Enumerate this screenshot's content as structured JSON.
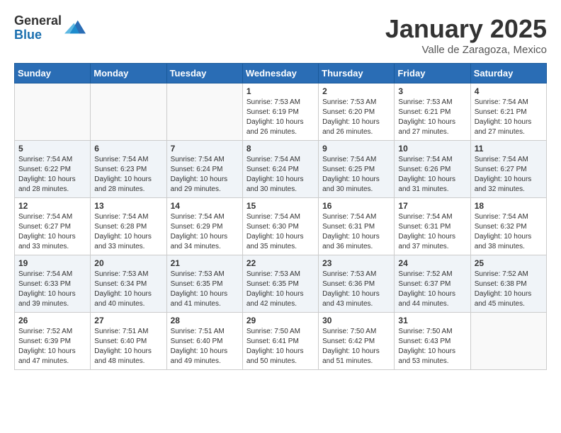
{
  "header": {
    "logo_general": "General",
    "logo_blue": "Blue",
    "month_title": "January 2025",
    "location": "Valle de Zaragoza, Mexico"
  },
  "days_of_week": [
    "Sunday",
    "Monday",
    "Tuesday",
    "Wednesday",
    "Thursday",
    "Friday",
    "Saturday"
  ],
  "weeks": [
    [
      {
        "day": "",
        "sunrise": "",
        "sunset": "",
        "daylight": ""
      },
      {
        "day": "",
        "sunrise": "",
        "sunset": "",
        "daylight": ""
      },
      {
        "day": "",
        "sunrise": "",
        "sunset": "",
        "daylight": ""
      },
      {
        "day": "1",
        "sunrise": "Sunrise: 7:53 AM",
        "sunset": "Sunset: 6:19 PM",
        "daylight": "Daylight: 10 hours and 26 minutes."
      },
      {
        "day": "2",
        "sunrise": "Sunrise: 7:53 AM",
        "sunset": "Sunset: 6:20 PM",
        "daylight": "Daylight: 10 hours and 26 minutes."
      },
      {
        "day": "3",
        "sunrise": "Sunrise: 7:53 AM",
        "sunset": "Sunset: 6:21 PM",
        "daylight": "Daylight: 10 hours and 27 minutes."
      },
      {
        "day": "4",
        "sunrise": "Sunrise: 7:54 AM",
        "sunset": "Sunset: 6:21 PM",
        "daylight": "Daylight: 10 hours and 27 minutes."
      }
    ],
    [
      {
        "day": "5",
        "sunrise": "Sunrise: 7:54 AM",
        "sunset": "Sunset: 6:22 PM",
        "daylight": "Daylight: 10 hours and 28 minutes."
      },
      {
        "day": "6",
        "sunrise": "Sunrise: 7:54 AM",
        "sunset": "Sunset: 6:23 PM",
        "daylight": "Daylight: 10 hours and 28 minutes."
      },
      {
        "day": "7",
        "sunrise": "Sunrise: 7:54 AM",
        "sunset": "Sunset: 6:24 PM",
        "daylight": "Daylight: 10 hours and 29 minutes."
      },
      {
        "day": "8",
        "sunrise": "Sunrise: 7:54 AM",
        "sunset": "Sunset: 6:24 PM",
        "daylight": "Daylight: 10 hours and 30 minutes."
      },
      {
        "day": "9",
        "sunrise": "Sunrise: 7:54 AM",
        "sunset": "Sunset: 6:25 PM",
        "daylight": "Daylight: 10 hours and 30 minutes."
      },
      {
        "day": "10",
        "sunrise": "Sunrise: 7:54 AM",
        "sunset": "Sunset: 6:26 PM",
        "daylight": "Daylight: 10 hours and 31 minutes."
      },
      {
        "day": "11",
        "sunrise": "Sunrise: 7:54 AM",
        "sunset": "Sunset: 6:27 PM",
        "daylight": "Daylight: 10 hours and 32 minutes."
      }
    ],
    [
      {
        "day": "12",
        "sunrise": "Sunrise: 7:54 AM",
        "sunset": "Sunset: 6:27 PM",
        "daylight": "Daylight: 10 hours and 33 minutes."
      },
      {
        "day": "13",
        "sunrise": "Sunrise: 7:54 AM",
        "sunset": "Sunset: 6:28 PM",
        "daylight": "Daylight: 10 hours and 33 minutes."
      },
      {
        "day": "14",
        "sunrise": "Sunrise: 7:54 AM",
        "sunset": "Sunset: 6:29 PM",
        "daylight": "Daylight: 10 hours and 34 minutes."
      },
      {
        "day": "15",
        "sunrise": "Sunrise: 7:54 AM",
        "sunset": "Sunset: 6:30 PM",
        "daylight": "Daylight: 10 hours and 35 minutes."
      },
      {
        "day": "16",
        "sunrise": "Sunrise: 7:54 AM",
        "sunset": "Sunset: 6:31 PM",
        "daylight": "Daylight: 10 hours and 36 minutes."
      },
      {
        "day": "17",
        "sunrise": "Sunrise: 7:54 AM",
        "sunset": "Sunset: 6:31 PM",
        "daylight": "Daylight: 10 hours and 37 minutes."
      },
      {
        "day": "18",
        "sunrise": "Sunrise: 7:54 AM",
        "sunset": "Sunset: 6:32 PM",
        "daylight": "Daylight: 10 hours and 38 minutes."
      }
    ],
    [
      {
        "day": "19",
        "sunrise": "Sunrise: 7:54 AM",
        "sunset": "Sunset: 6:33 PM",
        "daylight": "Daylight: 10 hours and 39 minutes."
      },
      {
        "day": "20",
        "sunrise": "Sunrise: 7:53 AM",
        "sunset": "Sunset: 6:34 PM",
        "daylight": "Daylight: 10 hours and 40 minutes."
      },
      {
        "day": "21",
        "sunrise": "Sunrise: 7:53 AM",
        "sunset": "Sunset: 6:35 PM",
        "daylight": "Daylight: 10 hours and 41 minutes."
      },
      {
        "day": "22",
        "sunrise": "Sunrise: 7:53 AM",
        "sunset": "Sunset: 6:35 PM",
        "daylight": "Daylight: 10 hours and 42 minutes."
      },
      {
        "day": "23",
        "sunrise": "Sunrise: 7:53 AM",
        "sunset": "Sunset: 6:36 PM",
        "daylight": "Daylight: 10 hours and 43 minutes."
      },
      {
        "day": "24",
        "sunrise": "Sunrise: 7:52 AM",
        "sunset": "Sunset: 6:37 PM",
        "daylight": "Daylight: 10 hours and 44 minutes."
      },
      {
        "day": "25",
        "sunrise": "Sunrise: 7:52 AM",
        "sunset": "Sunset: 6:38 PM",
        "daylight": "Daylight: 10 hours and 45 minutes."
      }
    ],
    [
      {
        "day": "26",
        "sunrise": "Sunrise: 7:52 AM",
        "sunset": "Sunset: 6:39 PM",
        "daylight": "Daylight: 10 hours and 47 minutes."
      },
      {
        "day": "27",
        "sunrise": "Sunrise: 7:51 AM",
        "sunset": "Sunset: 6:40 PM",
        "daylight": "Daylight: 10 hours and 48 minutes."
      },
      {
        "day": "28",
        "sunrise": "Sunrise: 7:51 AM",
        "sunset": "Sunset: 6:40 PM",
        "daylight": "Daylight: 10 hours and 49 minutes."
      },
      {
        "day": "29",
        "sunrise": "Sunrise: 7:50 AM",
        "sunset": "Sunset: 6:41 PM",
        "daylight": "Daylight: 10 hours and 50 minutes."
      },
      {
        "day": "30",
        "sunrise": "Sunrise: 7:50 AM",
        "sunset": "Sunset: 6:42 PM",
        "daylight": "Daylight: 10 hours and 51 minutes."
      },
      {
        "day": "31",
        "sunrise": "Sunrise: 7:50 AM",
        "sunset": "Sunset: 6:43 PM",
        "daylight": "Daylight: 10 hours and 53 minutes."
      },
      {
        "day": "",
        "sunrise": "",
        "sunset": "",
        "daylight": ""
      }
    ]
  ]
}
